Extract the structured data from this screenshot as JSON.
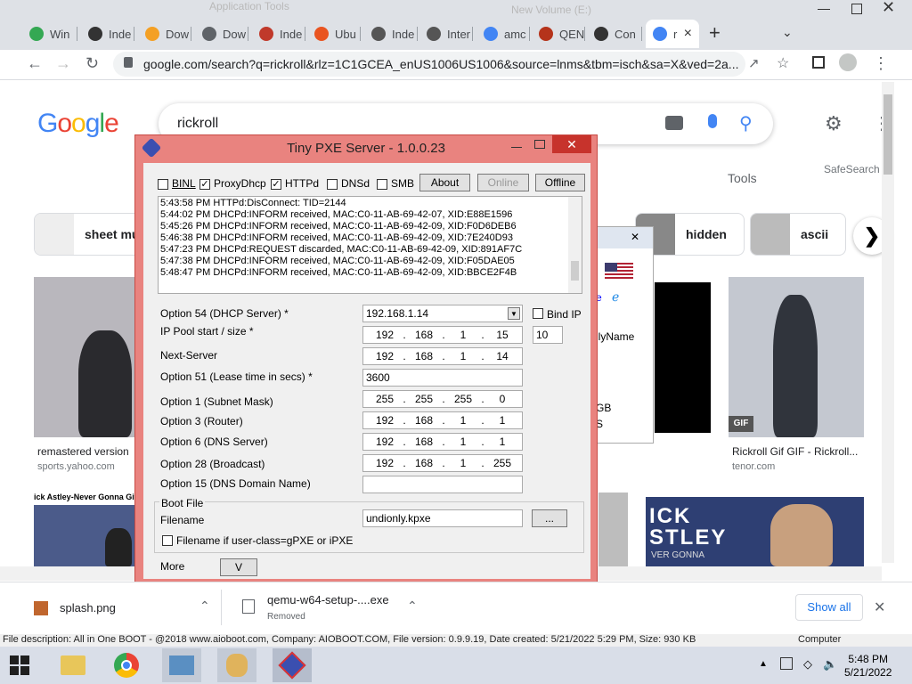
{
  "browser": {
    "window_title": "Application Tools",
    "window_title_right": "New Volume (E:)",
    "tabs": [
      {
        "label": "Win",
        "icon": "drive-icon"
      },
      {
        "label": "Inde",
        "icon": "github-icon"
      },
      {
        "label": "Dow",
        "icon": "diamond-icon"
      },
      {
        "label": "Dow",
        "icon": "download-icon"
      },
      {
        "label": "Inde",
        "icon": "arch-icon"
      },
      {
        "label": "Ubu",
        "icon": "ubuntu-icon"
      },
      {
        "label": "Inde",
        "icon": "globe-icon"
      },
      {
        "label": "Inter",
        "icon": "globe-icon"
      },
      {
        "label": "amc",
        "icon": "google-icon"
      },
      {
        "label": "QEN",
        "icon": "qemu-icon"
      },
      {
        "label": "Con",
        "icon": "github-icon"
      },
      {
        "label": "r",
        "icon": "google-icon",
        "active": true
      }
    ],
    "new_tab": "+",
    "url": "google.com/search?q=rickroll&rlz=1C1GCEA_enUS1006US1006&source=lnms&tbm=isch&sa=X&ved=2a..."
  },
  "google": {
    "logo": "Google",
    "query": "rickroll",
    "tools": "Tools",
    "safesearch": "SafeSearch",
    "chips": [
      {
        "label": "sheet mu"
      },
      {
        "label": "hidden"
      },
      {
        "label": "ascii"
      }
    ],
    "results": [
      {
        "caption": "remastered version",
        "source": "sports.yahoo.com"
      },
      {
        "caption": "Rickroll Gif GIF - Rickroll...",
        "source": "tenor.com",
        "badge": "GIF"
      },
      {
        "caption": "ick Astley-Never Gonna Give Y",
        "source": ""
      },
      {
        "caption": "ICK\nSTLEY",
        "source": "VER GONNA"
      }
    ]
  },
  "bg_window": {
    "lines": [
      "e",
      "llyName",
      "GB",
      "S"
    ]
  },
  "pxe": {
    "title": "Tiny PXE Server - 1.0.0.23",
    "checks": [
      {
        "label": "BINL",
        "checked": false
      },
      {
        "label": "ProxyDhcp",
        "checked": true
      },
      {
        "label": "HTTPd",
        "checked": true
      },
      {
        "label": "DNSd",
        "checked": false
      },
      {
        "label": "SMB",
        "checked": false
      }
    ],
    "buttons": {
      "about": "About",
      "online": "Online",
      "offline": "Offline"
    },
    "log": [
      "5:43:58 PM HTTPd:DisConnect: TID=2144",
      "5:44:02 PM DHCPd:INFORM received, MAC:C0-11-AB-69-42-07, XID:E88E1596",
      "5:45:26 PM DHCPd:INFORM received, MAC:C0-11-AB-69-42-09, XID:F0D6DEB6",
      "5:46:38 PM DHCPd:INFORM received, MAC:C0-11-AB-69-42-09, XID:7E240D93",
      "5:47:23 PM DHCPd:REQUEST discarded, MAC:C0-11-AB-69-42-09, XID:891AF7C",
      "5:47:38 PM DHCPd:INFORM received, MAC:C0-11-AB-69-42-09, XID:F05DAE05",
      "5:48:47 PM DHCPd:INFORM received, MAC:C0-11-AB-69-42-09, XID:BBCE2F4B"
    ],
    "opt54_label": "Option 54 (DHCP Server) *",
    "opt54_value": "192.168.1.14",
    "bind_ip": "Bind IP",
    "pool_label": "IP Pool start / size *",
    "pool_ip": [
      "192",
      "168",
      "1",
      "15"
    ],
    "pool_size": "10",
    "next_label": "Next-Server",
    "next_ip": [
      "192",
      "168",
      "1",
      "14"
    ],
    "opt51_label": "Option 51 (Lease time in secs) *",
    "opt51_value": "3600",
    "opt1_label": "Option 1  (Subnet Mask)",
    "opt1_ip": [
      "255",
      "255",
      "255",
      "0"
    ],
    "opt3_label": "Option 3  (Router)",
    "opt3_ip": [
      "192",
      "168",
      "1",
      "1"
    ],
    "opt6_label": "Option 6  (DNS Server)",
    "opt6_ip": [
      "192",
      "168",
      "1",
      "1"
    ],
    "opt28_label": "Option 28 (Broadcast)",
    "opt28_ip": [
      "192",
      "168",
      "1",
      "255"
    ],
    "opt15_label": "Option 15 (DNS Domain Name)",
    "opt15_value": "",
    "boot_group": "Boot File",
    "filename_label": "Filename",
    "filename_value": "undionly.kpxe",
    "browse": "...",
    "gpxe_label": "Filename if user-class=gPXE or iPXE",
    "more_label": "More",
    "more_button": "V"
  },
  "downloads": [
    {
      "name": "splash.png",
      "status": ""
    },
    {
      "name": "qemu-w64-setup-....exe",
      "status": "Removed"
    }
  ],
  "show_all": "Show all",
  "file_description": "File description: All in One BOOT - @2018 www.aioboot.com, Company: AIOBOOT.COM, File version: 0.9.9.19, Date created: 5/21/2022 5:29 PM, Size: 930 KB",
  "file_description_right": "Computer",
  "clock": {
    "time": "5:48 PM",
    "date": "5/21/2022"
  }
}
